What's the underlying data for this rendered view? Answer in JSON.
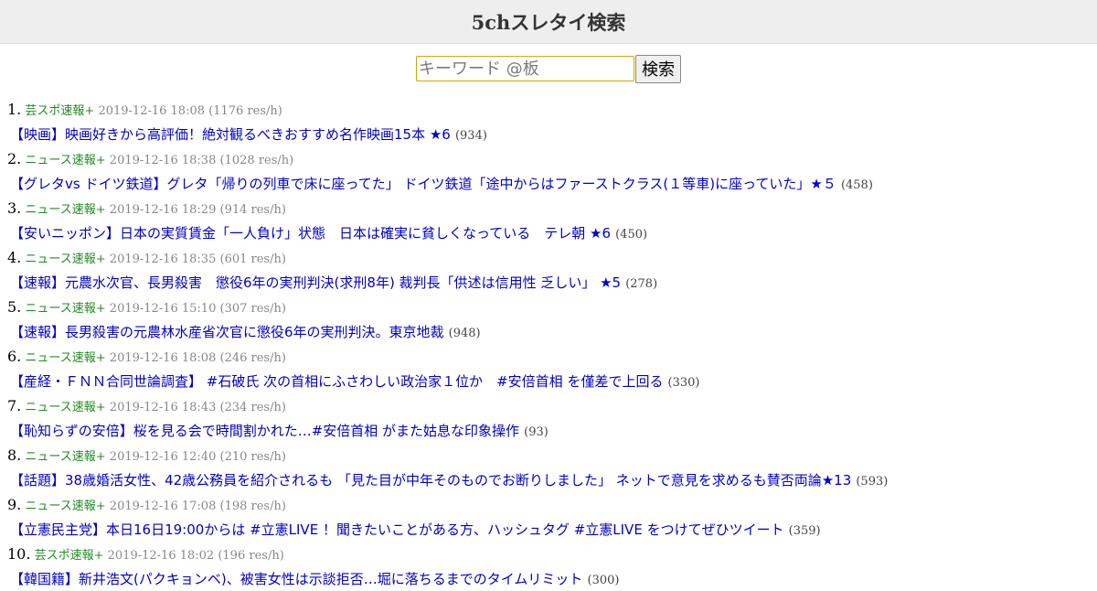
{
  "site_title": "5chスレタイ検索",
  "search": {
    "placeholder": "キーワード @板",
    "value": "",
    "button_label": "検索"
  },
  "results": [
    {
      "index": "1.",
      "board": "芸スポ速報+",
      "datetime": "2019-12-16 18:08",
      "speed": "(1176 res/h)",
      "title": "【映画】映画好きから高評価！絶対観るべきおすすめ名作映画15本 ★6",
      "count": "(934)"
    },
    {
      "index": "2.",
      "board": "ニュース速報+",
      "datetime": "2019-12-16 18:38",
      "speed": "(1028 res/h)",
      "title": "【グレタvs ドイツ鉄道】グレタ「帰りの列車で床に座ってた」 ドイツ鉄道「途中からはファーストクラス(１等車)に座っていた」★５",
      "count": "(458)"
    },
    {
      "index": "3.",
      "board": "ニュース速報+",
      "datetime": "2019-12-16 18:29",
      "speed": "(914 res/h)",
      "title": "【安いニッポン】日本の実質賃金「一人負け」状態　日本は確実に貧しくなっている　テレ朝 ★6",
      "count": "(450)"
    },
    {
      "index": "4.",
      "board": "ニュース速報+",
      "datetime": "2019-12-16 18:35",
      "speed": "(601 res/h)",
      "title": "【速報】元農水次官、長男殺害　懲役6年の実刑判決(求刑8年) 裁判長「供述は信用性 乏しい」 ★5",
      "count": "(278)"
    },
    {
      "index": "5.",
      "board": "ニュース速報+",
      "datetime": "2019-12-16 15:10",
      "speed": "(307 res/h)",
      "title": "【速報】長男殺害の元農林水産省次官に懲役6年の実刑判決。東京地裁",
      "count": "(948)"
    },
    {
      "index": "6.",
      "board": "ニュース速報+",
      "datetime": "2019-12-16 18:08",
      "speed": "(246 res/h)",
      "title": "【産経・ＦＮＮ合同世論調査】 #石破氏 次の首相にふさわしい政治家１位か　#安倍首相 を僅差で上回る",
      "count": "(330)"
    },
    {
      "index": "7.",
      "board": "ニュース速報+",
      "datetime": "2019-12-16 18:43",
      "speed": "(234 res/h)",
      "title": "【恥知らずの安倍】桜を見る会で時間割かれた…#安倍首相 がまた姑息な印象操作",
      "count": "(93)"
    },
    {
      "index": "8.",
      "board": "ニュース速報+",
      "datetime": "2019-12-16 12:40",
      "speed": "(210 res/h)",
      "title": "【話題】38歳婚活女性、42歳公務員を紹介されるも 「見た目が中年そのものでお断りしました」 ネットで意見を求めるも賛否両論★13",
      "count": "(593)"
    },
    {
      "index": "9.",
      "board": "ニュース速報+",
      "datetime": "2019-12-16 17:08",
      "speed": "(198 res/h)",
      "title": "【立憲民主党】本日16日19:00からは #立憲LIVE ！聞きたいことがある方、ハッシュタグ #立憲LIVE をつけてぜひツイート",
      "count": "(359)"
    },
    {
      "index": "10.",
      "board": "芸スポ速報+",
      "datetime": "2019-12-16 18:02",
      "speed": "(196 res/h)",
      "title": "【韓国籍】新井浩文(パクキョンベ)、被害女性は示談拒否…堀に落ちるまでのタイムリミット",
      "count": "(300)"
    }
  ]
}
